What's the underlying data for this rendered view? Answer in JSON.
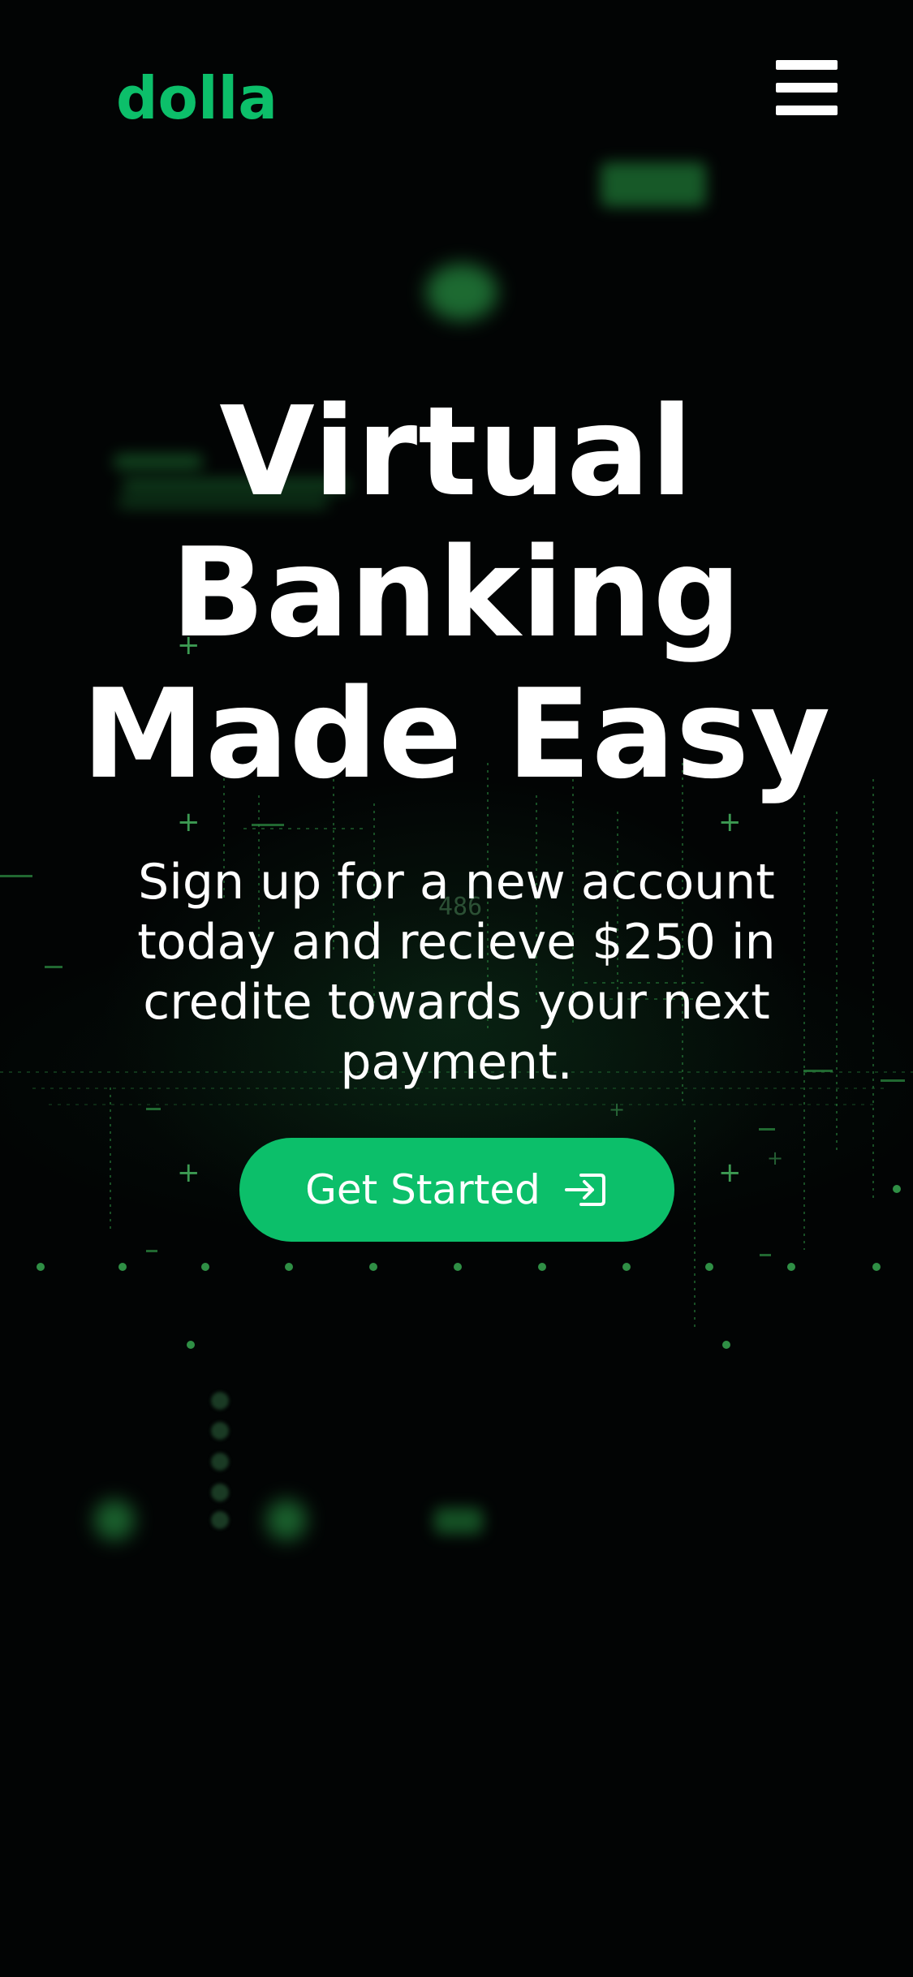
{
  "brand": {
    "logo_text": "dolla",
    "accent_color": "#0cbf6a"
  },
  "header": {
    "menu_icon": "hamburger-menu-icon"
  },
  "hero": {
    "title_lines": [
      "Virtual",
      "Banking",
      "Made Easy"
    ],
    "subtitle": "Sign up for a new account today and recieve $250 in credite towards your next payment.",
    "cta_label": "Get Started",
    "cta_icon": "sign-in-arrow-icon"
  },
  "background": {
    "decor_number": "486"
  }
}
